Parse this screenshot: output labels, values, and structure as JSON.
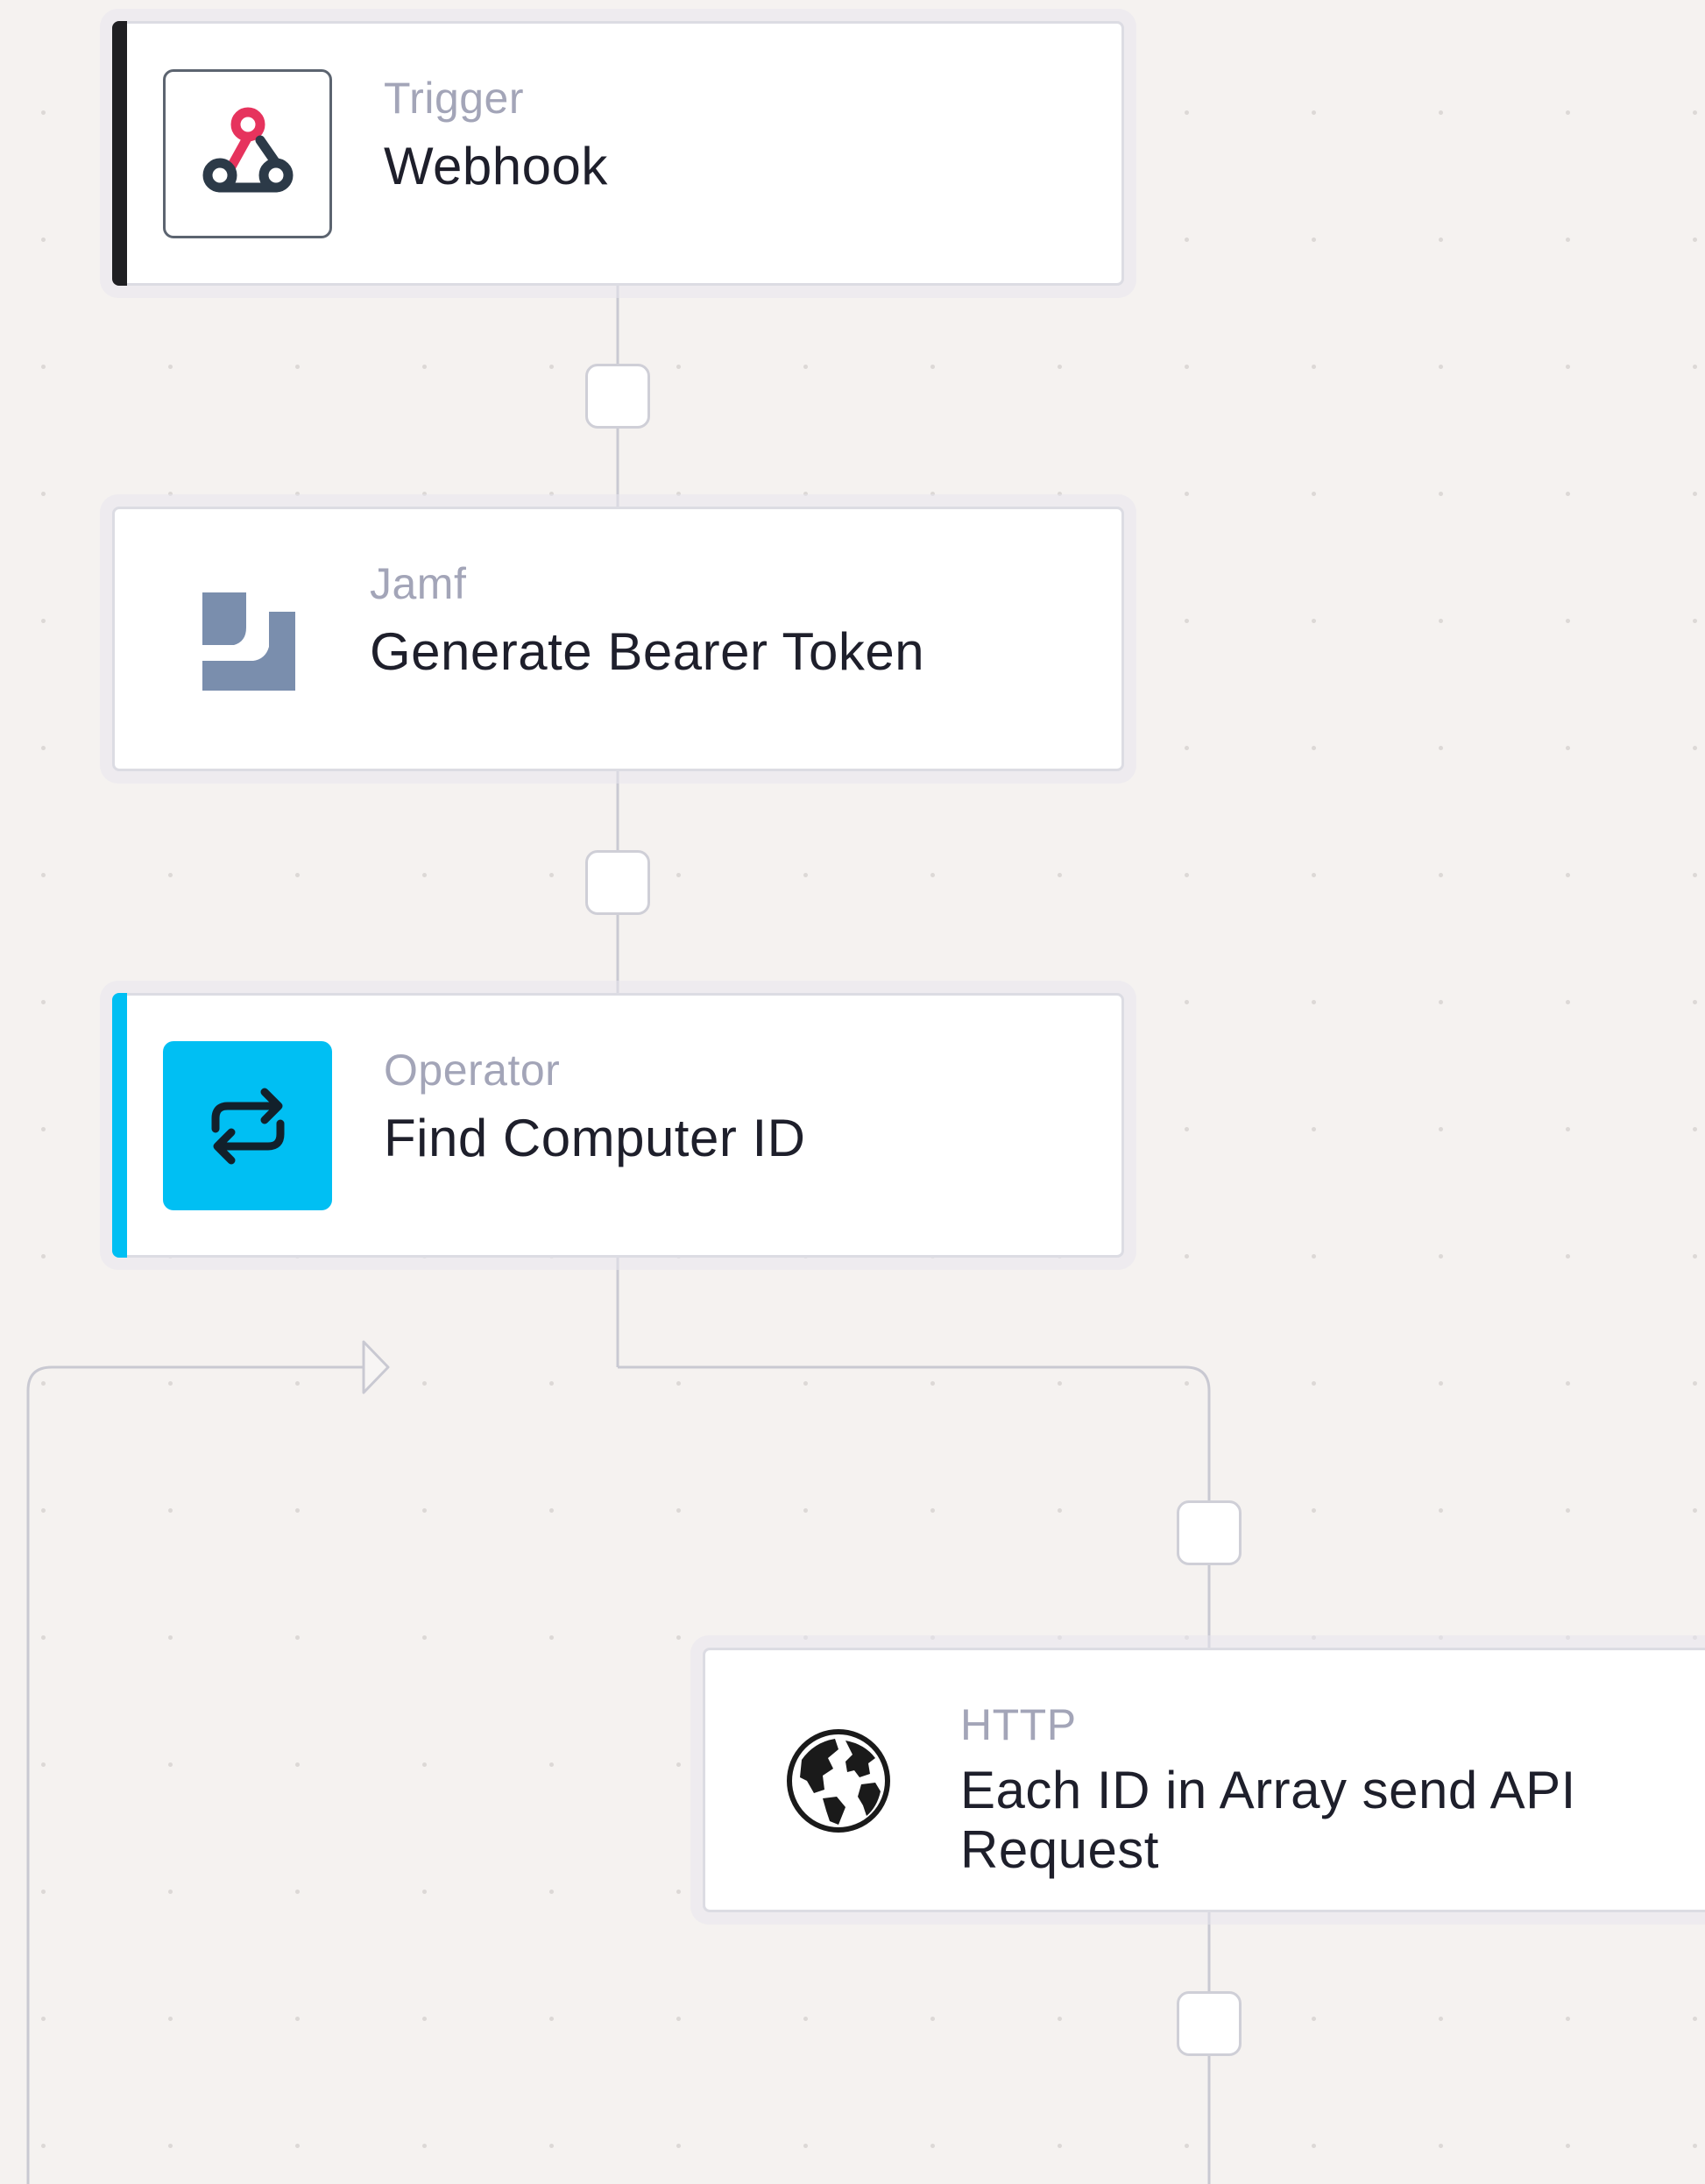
{
  "workflow": {
    "nodes": [
      {
        "id": "trigger",
        "kind": "Trigger",
        "title": "Webhook",
        "icon": "webhook-icon",
        "accent": "#1f1f22"
      },
      {
        "id": "jamf",
        "kind": "Jamf",
        "title": "Generate Bearer Token",
        "icon": "jamf-logo-icon",
        "accent_icon_color": "#7a8ead"
      },
      {
        "id": "operator",
        "kind": "Operator",
        "title": "Find Computer ID",
        "icon": "loop-arrows-icon",
        "accent": "#00bff3"
      },
      {
        "id": "http",
        "kind": "HTTP",
        "title": "Each ID in Array send API Request",
        "icon": "globe-icon"
      }
    ],
    "colors": {
      "canvas": "#f5f2f0",
      "connector": "#c9c9d2",
      "node_border": "#dcdce3",
      "webhook_red": "#e6335d",
      "webhook_dark": "#2c3a48"
    }
  }
}
